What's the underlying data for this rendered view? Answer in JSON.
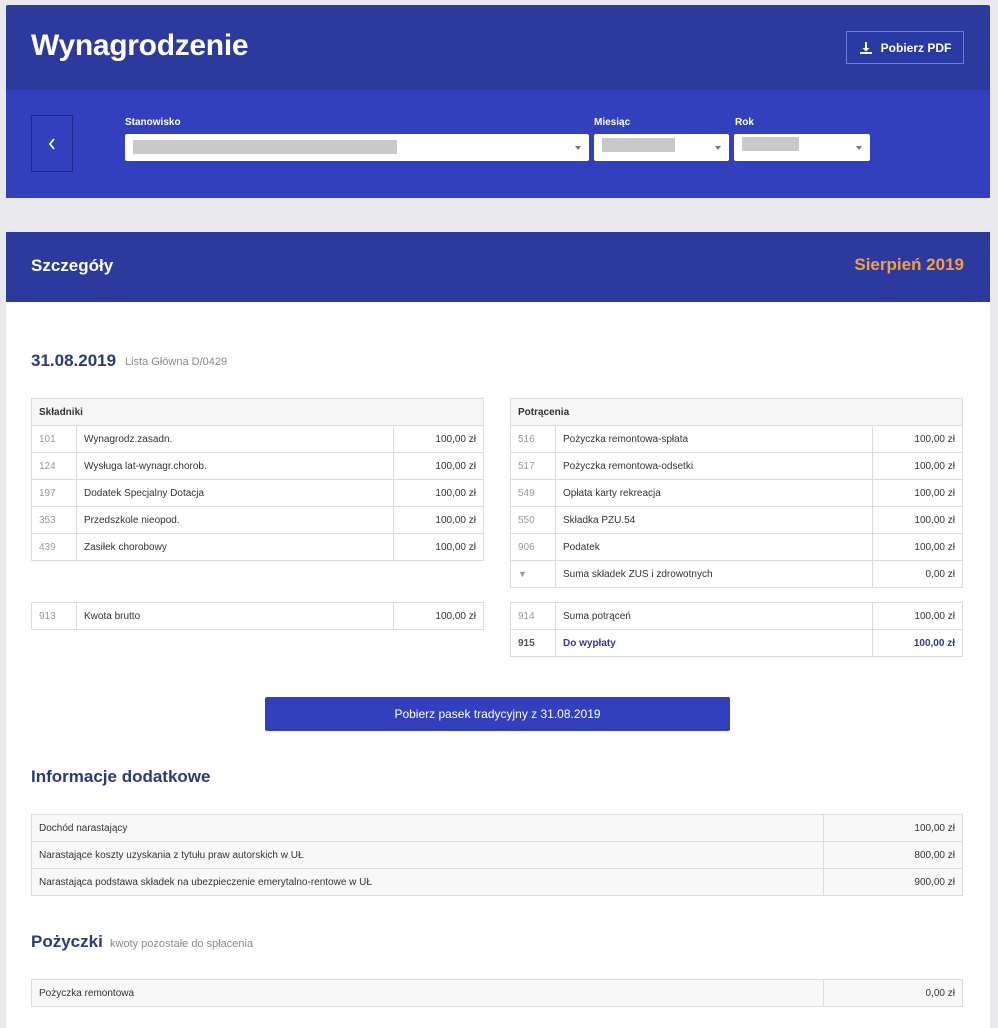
{
  "header": {
    "title": "Wynagrodzenie",
    "pdf_label": "Pobierz PDF",
    "filters": {
      "position_label": "Stanowisko",
      "month_label": "Miesiąc",
      "year_label": "Rok"
    }
  },
  "details": {
    "title": "Szczegóły",
    "period": "Sierpień 2019",
    "date": "31.08.2019",
    "list_name": "Lista Główna D/0429",
    "components": {
      "header": "Składniki",
      "rows": [
        {
          "code": "101",
          "name": "Wynagrodz.zasadn.",
          "value": "100,00 zł"
        },
        {
          "code": "124",
          "name": "Wysługa lat-wynagr.chorob.",
          "value": "100,00 zł"
        },
        {
          "code": "197",
          "name": "Dodatek Specjalny Dotacja",
          "value": "100,00 zł"
        },
        {
          "code": "353",
          "name": "Przedszkole nieopod.",
          "value": "100,00 zł"
        },
        {
          "code": "439",
          "name": "Zasiłek chorobowy",
          "value": "100,00 zł"
        }
      ],
      "total": {
        "code": "913",
        "name": "Kwota brutto",
        "value": "100,00 zł"
      }
    },
    "deductions": {
      "header": "Potrącenia",
      "rows": [
        {
          "code": "516",
          "name": "Pożyczka remontowa-spłata",
          "value": "100,00 zł"
        },
        {
          "code": "517",
          "name": "Pożyczka remontowa-odsetki",
          "value": "100,00 zł"
        },
        {
          "code": "549",
          "name": "Opłata karty rekreacja",
          "value": "100,00 zł"
        },
        {
          "code": "550",
          "name": "Składka PZU.54",
          "value": "100,00 zł"
        },
        {
          "code": "906",
          "name": "Podatek",
          "value": "100,00 zł"
        }
      ],
      "zus": {
        "code": "▼",
        "name": "Suma składek ZUS i zdrowotnych",
        "value": "0,00 zł"
      },
      "sum": {
        "code": "914",
        "name": "Suma potrąceń",
        "value": "100,00 zł"
      },
      "payout": {
        "code": "915",
        "name": "Do wypłaty",
        "value": "100,00 zł"
      }
    },
    "download_label": "Pobierz pasek tradycyjny z 31.08.2019"
  },
  "additional": {
    "title": "Informacje dodatkowe",
    "rows": [
      {
        "name": "Dochód narastający",
        "value": "100,00 zł"
      },
      {
        "name": "Narastające koszty uzyskania z tytułu praw autorskich w UŁ",
        "value": "800,00 zł"
      },
      {
        "name": "Narastająca podstawa składek na ubezpieczenie emerytalno-rentowe w UŁ",
        "value": "900,00 zł"
      }
    ]
  },
  "loans": {
    "title": "Pożyczki",
    "subtitle": "kwoty pozostałe do spłacenia",
    "rows": [
      {
        "name": "Pożyczka remontowa",
        "value": "0,00 zł"
      }
    ]
  }
}
